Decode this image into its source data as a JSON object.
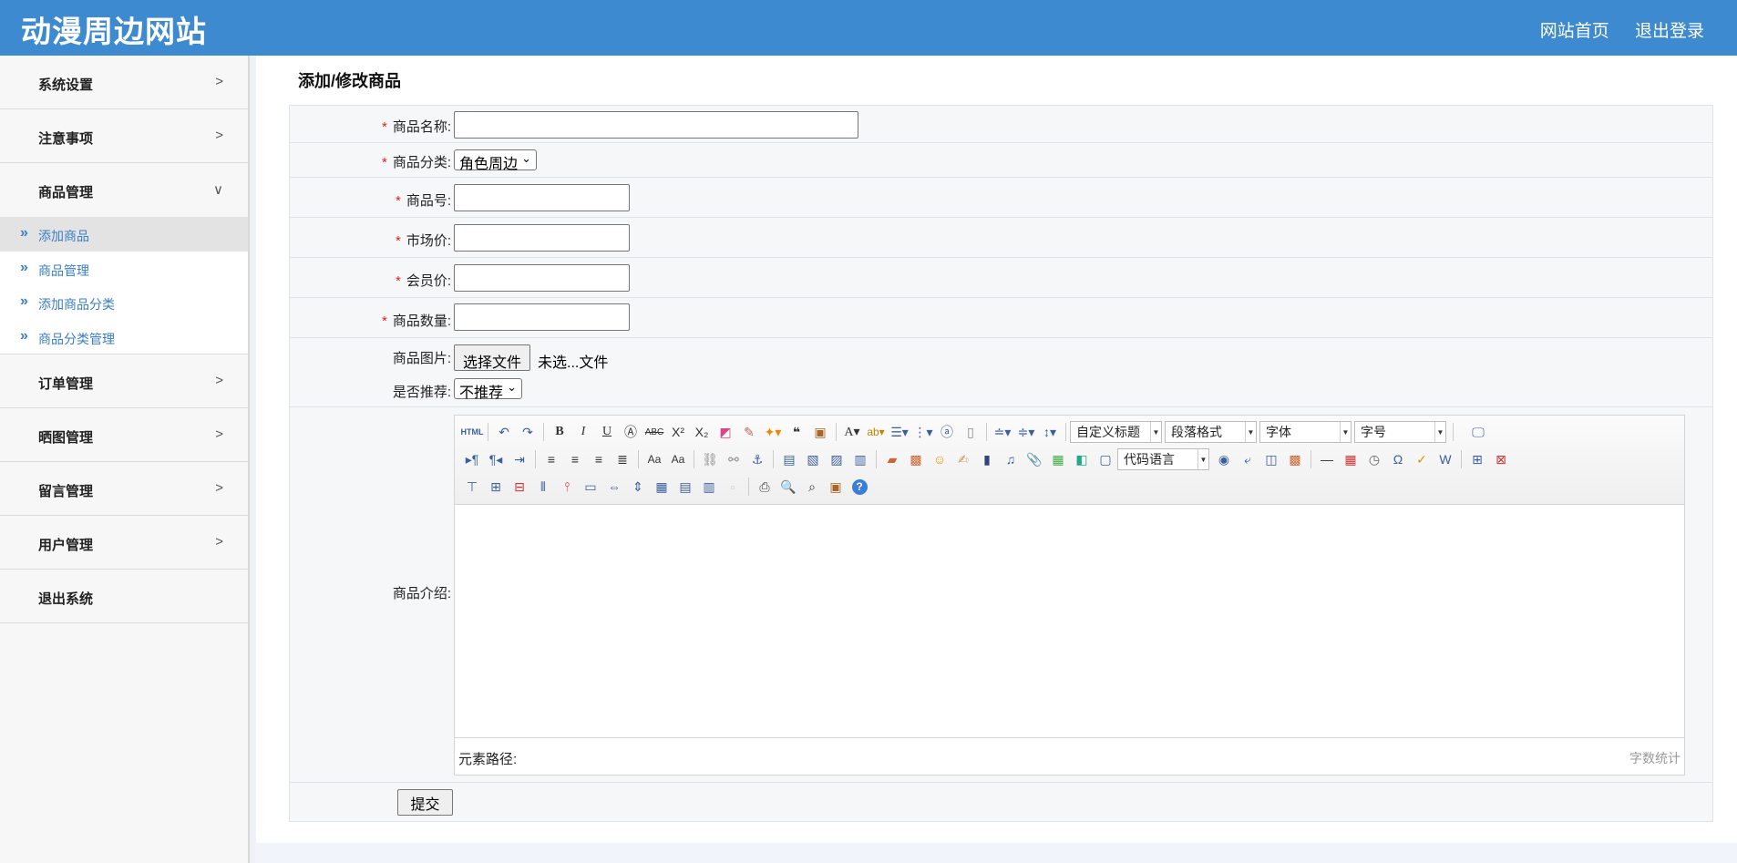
{
  "header": {
    "brand": "动漫周边网站",
    "links": [
      "网站首页",
      "退出登录"
    ]
  },
  "sidebar": {
    "items": [
      {
        "label": "系统设置",
        "arrow": ">"
      },
      {
        "label": "注意事项",
        "arrow": ">"
      },
      {
        "label": "商品管理",
        "arrow": "∨"
      },
      {
        "label": "订单管理",
        "arrow": ">"
      },
      {
        "label": "晒图管理",
        "arrow": ">"
      },
      {
        "label": "留言管理",
        "arrow": ">"
      },
      {
        "label": "用户管理",
        "arrow": ">"
      },
      {
        "label": "退出系统",
        "arrow": ""
      }
    ],
    "submenu_icon": "»",
    "submenu": [
      {
        "label": "添加商品",
        "active": true
      },
      {
        "label": "商品管理",
        "active": false
      },
      {
        "label": "添加商品分类",
        "active": false
      },
      {
        "label": "商品分类管理",
        "active": false
      }
    ]
  },
  "page": {
    "title": "添加/修改商品"
  },
  "form": {
    "required_mark": "*",
    "name_label": "商品名称:",
    "name_value": "",
    "category_label": "商品分类:",
    "category_value": "角色周边",
    "number_label": "商品号:",
    "number_value": "",
    "market_price_label": "市场价:",
    "market_price_value": "",
    "member_price_label": "会员价:",
    "member_price_value": "",
    "quantity_label": "商品数量:",
    "quantity_value": "",
    "image_label": "商品图片:",
    "file_button": "选择文件",
    "file_status": "未选...文件",
    "recommend_label": "是否推荐:",
    "recommend_value": "不推荐",
    "intro_label": "商品介绍:",
    "submit_label": "提交"
  },
  "editor": {
    "combos": {
      "heading": "自定义标题",
      "paragraph": "段落格式",
      "font": "字体",
      "size": "字号",
      "code": "代码语言"
    },
    "element_path": "元素路径:",
    "word_count": "字数统计",
    "toolbar_icons": [
      "html-source-icon",
      "undo-icon",
      "redo-icon",
      "bold-icon",
      "italic-icon",
      "underline-icon",
      "font-border-icon",
      "strikethrough-icon",
      "superscript-icon",
      "subscript-icon",
      "eraser-icon",
      "format-brush-icon",
      "auto-format-icon",
      "blockquote-icon",
      "paste-text-icon",
      "font-color-icon",
      "highlight-icon",
      "ordered-list-icon",
      "unordered-list-icon",
      "select-all-icon",
      "clear-doc-icon",
      "row-spacing-top-icon",
      "row-spacing-bottom-icon",
      "line-height-icon",
      "fullscreen-icon",
      "ltr-icon",
      "rtl-icon",
      "indent-icon",
      "align-left-icon",
      "align-center-icon",
      "align-right-icon",
      "justify-icon",
      "upper-case-icon",
      "lower-case-icon",
      "link-icon",
      "unlink-icon",
      "anchor-icon",
      "image-none-icon",
      "image-left-icon",
      "image-right-icon",
      "image-center-icon",
      "simple-upload-icon",
      "insert-image-icon",
      "emotion-icon",
      "scrawl-icon",
      "insert-video-icon",
      "music-icon",
      "attachment-icon",
      "map-icon",
      "gmap-icon",
      "insert-frame-icon",
      "web-app-icon",
      "page-break-icon",
      "template-icon",
      "background-icon",
      "horizontal-line-icon",
      "date-icon",
      "time-icon",
      "special-chars-icon",
      "spell-check-icon",
      "word-image-icon",
      "insert-table-icon",
      "delete-table-icon",
      "insert-paragraph-before-table-icon",
      "insert-row-icon",
      "delete-row-icon",
      "insert-col-icon",
      "delete-col-icon",
      "merge-cells-icon",
      "merge-right-icon",
      "merge-down-icon",
      "split-cells-icon",
      "split-rows-icon",
      "split-cols-icon",
      "charts-icon",
      "print-icon",
      "preview-icon",
      "search-replace-icon",
      "draft-icon",
      "help-icon"
    ]
  }
}
